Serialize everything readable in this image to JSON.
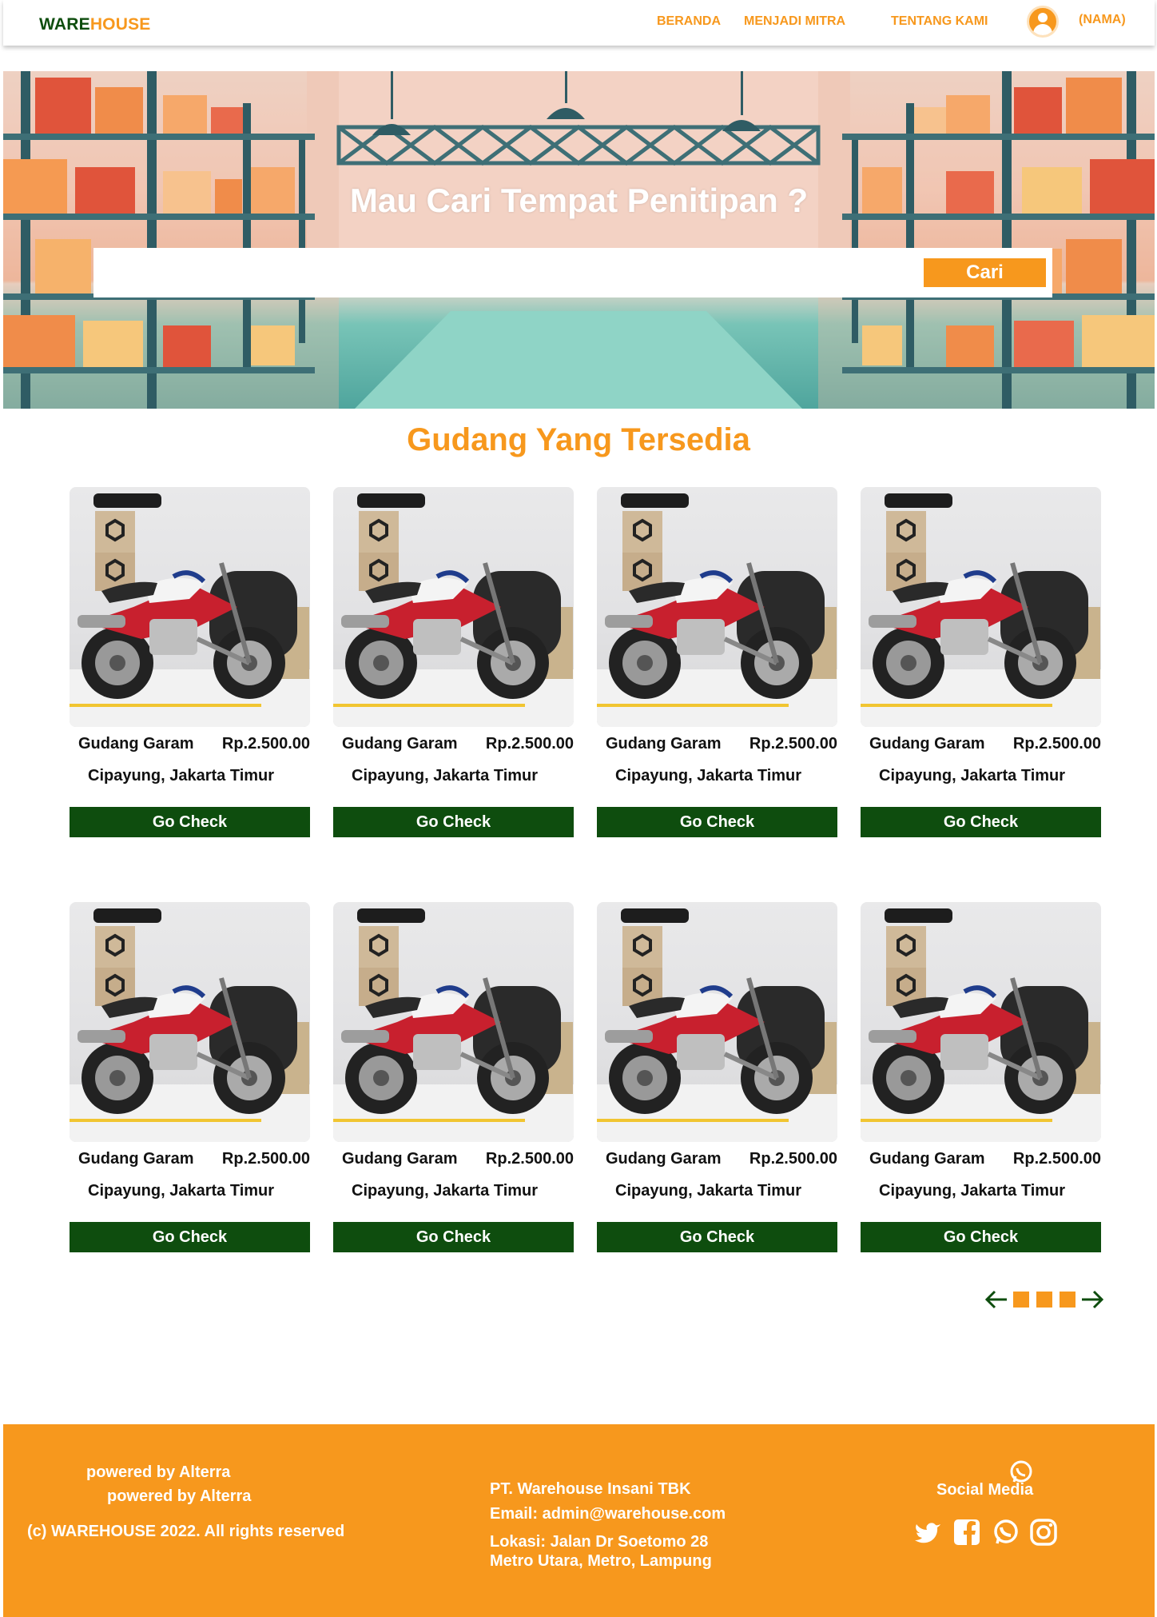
{
  "nav": {
    "logo_part1": "WARE",
    "logo_part2": "HOUSE",
    "links": [
      "BERANDA",
      "MENJADI MITRA",
      "TENTANG KAMI"
    ],
    "user_name": "(NAMA)"
  },
  "hero": {
    "title": "Mau Cari Tempat Penitipan ?",
    "search_placeholder": "",
    "search_button": "Cari"
  },
  "section_title": "Gudang Yang Tersedia",
  "cards": [
    {
      "name": "Gudang Garam",
      "price": "Rp.2.500.00",
      "location": "Cipayung, Jakarta Timur",
      "button": "Go Check"
    },
    {
      "name": "Gudang Garam",
      "price": "Rp.2.500.00",
      "location": "Cipayung, Jakarta Timur",
      "button": "Go Check"
    },
    {
      "name": "Gudang Garam",
      "price": "Rp.2.500.00",
      "location": "Cipayung, Jakarta Timur",
      "button": "Go Check"
    },
    {
      "name": "Gudang Garam",
      "price": "Rp.2.500.00",
      "location": "Cipayung, Jakarta Timur",
      "button": "Go Check"
    },
    {
      "name": "Gudang Garam",
      "price": "Rp.2.500.00",
      "location": "Cipayung, Jakarta Timur",
      "button": "Go Check"
    },
    {
      "name": "Gudang Garam",
      "price": "Rp.2.500.00",
      "location": "Cipayung, Jakarta Timur",
      "button": "Go Check"
    },
    {
      "name": "Gudang Garam",
      "price": "Rp.2.500.00",
      "location": "Cipayung, Jakarta Timur",
      "button": "Go Check"
    },
    {
      "name": "Gudang Garam",
      "price": "Rp.2.500.00",
      "location": "Cipayung, Jakarta Timur",
      "button": "Go Check"
    }
  ],
  "pagination": {
    "pages": 3
  },
  "footer": {
    "powered_1": "powered by Alterra",
    "powered_2": "powered by Alterra",
    "copyright": "(c) WAREHOUSE 2022. All rights reserved",
    "company": "PT. Warehouse Insani TBK",
    "email": "Email: admin@warehouse.com",
    "address_1": "Lokasi: Jalan Dr Soetomo 28",
    "address_2": "Metro Utara, Metro, Lampung",
    "social_title": "Social Media",
    "social_icons": [
      "twitter-icon",
      "facebook-icon",
      "whatsapp-icon",
      "instagram-icon"
    ]
  },
  "colors": {
    "brand_orange": "#f7981d",
    "brand_green": "#0e4d0e"
  }
}
